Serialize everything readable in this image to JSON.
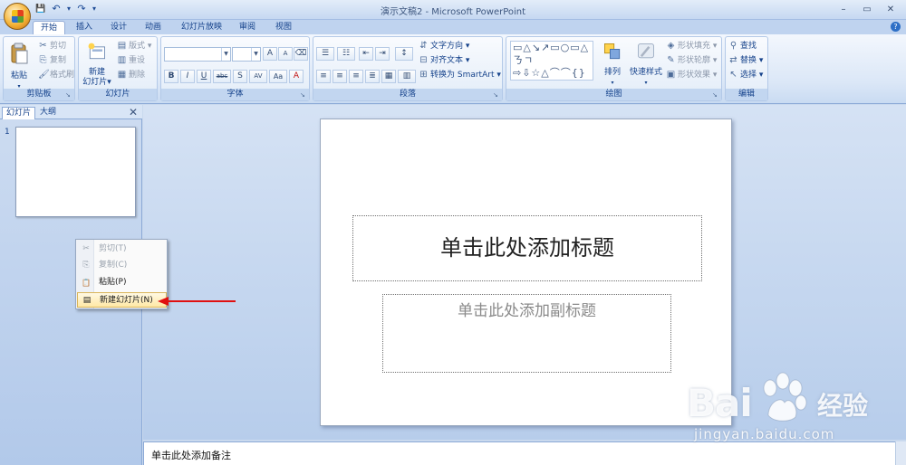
{
  "window": {
    "title": "演示文稿2 - Microsoft PowerPoint",
    "ctrl_min": "–",
    "ctrl_max": "▭",
    "ctrl_close": "✕"
  },
  "qat": {
    "save": "💾",
    "undo": "↶",
    "redo": "↷",
    "more": "▾"
  },
  "tabs": [
    {
      "label": "开始"
    },
    {
      "label": "插入"
    },
    {
      "label": "设计"
    },
    {
      "label": "动画"
    },
    {
      "label": "幻灯片放映"
    },
    {
      "label": "审阅"
    },
    {
      "label": "视图"
    }
  ],
  "help": "?",
  "ribbon": {
    "clipboard": {
      "label": "剪贴板",
      "paste": "粘贴",
      "cut": "剪切",
      "copy": "复制",
      "format_painter": "格式刷"
    },
    "slides": {
      "label": "幻灯片",
      "new_slide_1": "新建",
      "new_slide_2": "幻灯片",
      "layout": "版式",
      "reset": "重设",
      "delete": "删除"
    },
    "font": {
      "label": "字体",
      "grow": "A",
      "shrink": "A",
      "clear": "⌫",
      "bold": "B",
      "italic": "I",
      "underline": "U",
      "strike": "abc",
      "shadow": "S",
      "spacing": "AV",
      "case": "Aa",
      "color": "A"
    },
    "paragraph": {
      "label": "段落",
      "text_direction": "文字方向",
      "align_text": "对齐文本",
      "smartart": "转换为 SmartArt"
    },
    "drawing": {
      "label": "绘图",
      "shapes": "▭△↘↗▭○▭△ㄋㄱ⇨⇩☆△⌒⌒{}",
      "arrange": "排列",
      "quick_styles": "快速样式",
      "fill": "形状填充",
      "outline": "形状轮廓",
      "effects": "形状效果"
    },
    "editing": {
      "label": "编辑",
      "find": "查找",
      "replace": "替换",
      "select": "选择"
    }
  },
  "panel": {
    "tab_slides": "幻灯片",
    "tab_outline": "大纲",
    "close": "✕",
    "slide_number": "1"
  },
  "context_menu": {
    "items": [
      {
        "label": "剪切(T)",
        "icon": "✂"
      },
      {
        "label": "复制(C)",
        "icon": "⎘"
      },
      {
        "label": "粘贴(P)",
        "icon": "📋"
      },
      {
        "label": "新建幻灯片(N)",
        "icon": "▤"
      }
    ]
  },
  "slide": {
    "title_placeholder": "单击此处添加标题",
    "subtitle_placeholder": "单击此处添加副标题"
  },
  "notes": {
    "placeholder": "单击此处添加备注"
  },
  "watermark": {
    "logo_left": "Bai",
    "logo_right": "经验",
    "url": "jingyan.baidu.com"
  },
  "colors": {
    "ribbon_text": "#15428b",
    "accent": "#2d6fc6",
    "arrow": "#e01010"
  }
}
